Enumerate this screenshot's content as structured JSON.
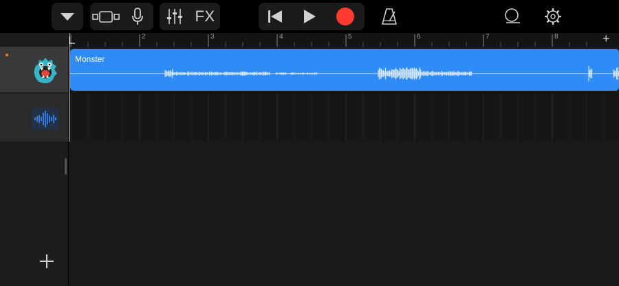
{
  "toolbar": {
    "fx_label": "FX",
    "icons": [
      "dropdown-triangle-icon",
      "browser-view-icon",
      "microphone-icon",
      "mixer-sliders-icon",
      "fx-button",
      "go-to-beginning-icon",
      "play-icon",
      "record-icon",
      "metronome-icon",
      "loop-icon",
      "settings-gear-icon"
    ],
    "colors": {
      "record": "#ff3b30",
      "icon": "#d0d0d0"
    }
  },
  "ruler": {
    "bars": [
      "1",
      "2",
      "3",
      "4",
      "5",
      "6",
      "7",
      "8"
    ],
    "add_label": "+"
  },
  "tracks": [
    {
      "name": "Monster",
      "instrument": "monster-voice-icon",
      "selected": true,
      "region_color": "#2f8cf7"
    },
    {
      "name": "",
      "instrument": "audio-recorder-waveform-icon",
      "selected": false
    }
  ],
  "add_track_label": "+"
}
